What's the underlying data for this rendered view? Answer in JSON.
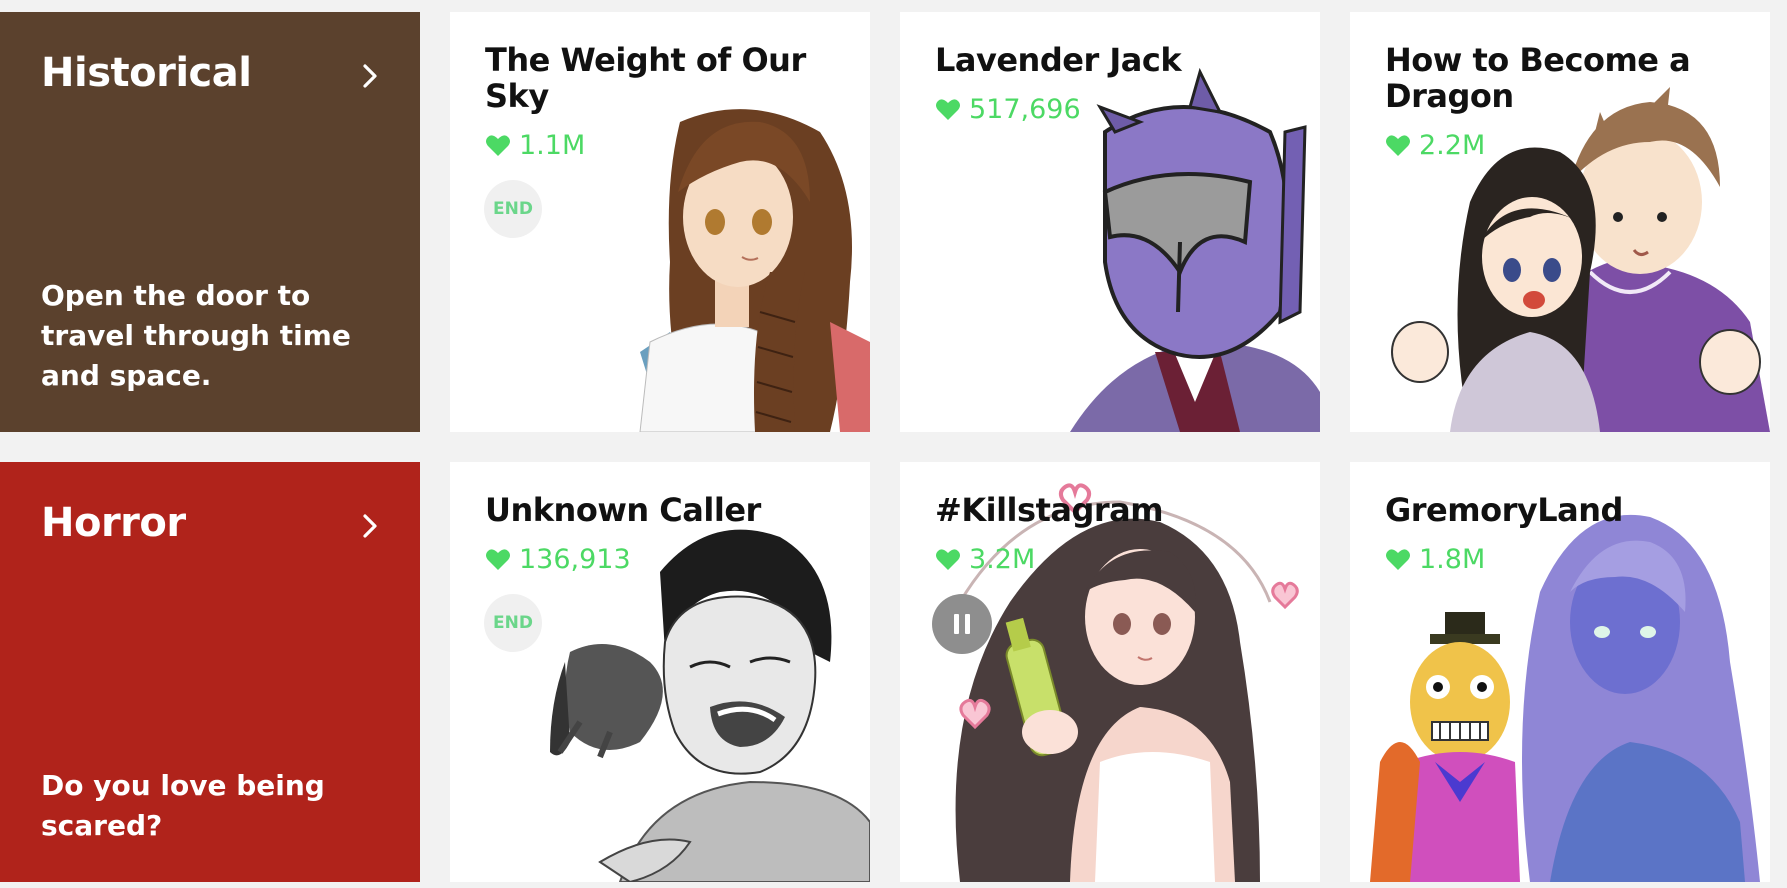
{
  "genres": [
    {
      "title": "Historical",
      "description": "Open the door to travel through time and space.",
      "color": "#5b412d",
      "cards": [
        {
          "title": "The Weight of Our Sky",
          "likes": "1.1M",
          "badge": "END"
        },
        {
          "title": "Lavender Jack",
          "likes": "517,696",
          "badge": ""
        },
        {
          "title": "How to Become a Dragon",
          "likes": "2.2M",
          "badge": ""
        }
      ]
    },
    {
      "title": "Horror",
      "description": "Do you love being scared?",
      "color": "#b0231b",
      "cards": [
        {
          "title": "Unknown Caller",
          "likes": "136,913",
          "badge": "END"
        },
        {
          "title": "#Killstagram",
          "likes": "3.2M",
          "badge": "pause"
        },
        {
          "title": "GremoryLand",
          "likes": "1.8M",
          "badge": ""
        }
      ]
    }
  ],
  "icons": {
    "arrow": "chevron-right-icon",
    "like": "heart-icon",
    "pause": "pause-icon"
  },
  "colors": {
    "like_green": "#4cd964",
    "background": "#f2f2f2"
  }
}
